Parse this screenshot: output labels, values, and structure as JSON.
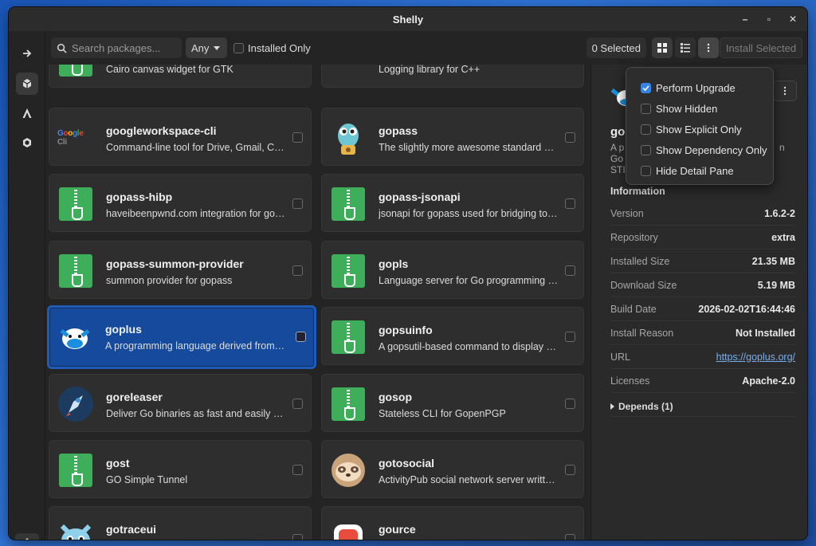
{
  "window": {
    "title": "Shelly"
  },
  "toolbar": {
    "search_placeholder": "Search packages...",
    "filter_value": "Any",
    "installed_only_label": "Installed Only",
    "selected_count": "0 Selected",
    "install_label": "Install Selected"
  },
  "packages": [
    {
      "name": "",
      "desc": "Cairo canvas widget for GTK",
      "icon": "zip-icon"
    },
    {
      "name": "",
      "desc": "Logging library for C++",
      "icon": "google-logo-icon"
    },
    {
      "name": "googleworkspace-cli",
      "desc": "Command-line tool for Drive, Gmail, Calendar",
      "icon": "google-logo-icon"
    },
    {
      "name": "gopass",
      "desc": "The slightly more awesome standard unix password manager",
      "icon": "gopass-gopher-icon"
    },
    {
      "name": "gopass-hibp",
      "desc": "haveibeenpwnd.com integration for gopass",
      "icon": "zip-icon"
    },
    {
      "name": "gopass-jsonapi",
      "desc": "jsonapi for gopass used for bridging to browser",
      "icon": "zip-icon"
    },
    {
      "name": "gopass-summon-provider",
      "desc": "summon provider for gopass",
      "icon": "zip-icon"
    },
    {
      "name": "gopls",
      "desc": "Language server for Go programming language",
      "icon": "zip-icon"
    },
    {
      "name": "goplus",
      "desc": "A programming language derived from Go",
      "icon": "goplus-cow-icon",
      "selected": true
    },
    {
      "name": "gopsuinfo",
      "desc": "A gopsutil-based command to display system info",
      "icon": "zip-icon"
    },
    {
      "name": "goreleaser",
      "desc": "Deliver Go binaries as fast and easily as possible",
      "icon": "goreleaser-rocket-icon"
    },
    {
      "name": "gosop",
      "desc": "Stateless CLI for GopenPGP",
      "icon": "zip-icon"
    },
    {
      "name": "gost",
      "desc": "GO Simple Tunnel",
      "icon": "zip-icon"
    },
    {
      "name": "gotosocial",
      "desc": "ActivityPub social network server written in Go",
      "icon": "sloth-icon"
    },
    {
      "name": "gotraceui",
      "desc": "",
      "icon": "gopher-cat-icon"
    },
    {
      "name": "gource",
      "desc": "",
      "icon": "gource-icon"
    }
  ],
  "menu": {
    "items": [
      {
        "label": "Perform Upgrade",
        "checked": true
      },
      {
        "label": "Show Hidden",
        "checked": false
      },
      {
        "label": "Show Explicit Only",
        "checked": false
      },
      {
        "label": "Show Dependency Only",
        "checked": false
      },
      {
        "label": "Hide Detail Pane",
        "checked": false
      }
    ]
  },
  "detail": {
    "name_fragment": "go",
    "desc_lines": [
      "A p",
      "Go",
      "STI"
    ],
    "desc_right": "n",
    "section_title": "Information",
    "rows": [
      {
        "k": "Version",
        "v": "1.6.2-2"
      },
      {
        "k": "Repository",
        "v": "extra"
      },
      {
        "k": "Installed Size",
        "v": "21.35 MB"
      },
      {
        "k": "Download Size",
        "v": "5.19 MB"
      },
      {
        "k": "Build Date",
        "v": "2026-02-02T16:44:46"
      },
      {
        "k": "Install Reason",
        "v": "Not Installed"
      },
      {
        "k": "URL",
        "v": "https://goplus.org/",
        "link": true
      },
      {
        "k": "Licenses",
        "v": "Apache-2.0"
      }
    ],
    "depends_label": "Depends (1)"
  }
}
